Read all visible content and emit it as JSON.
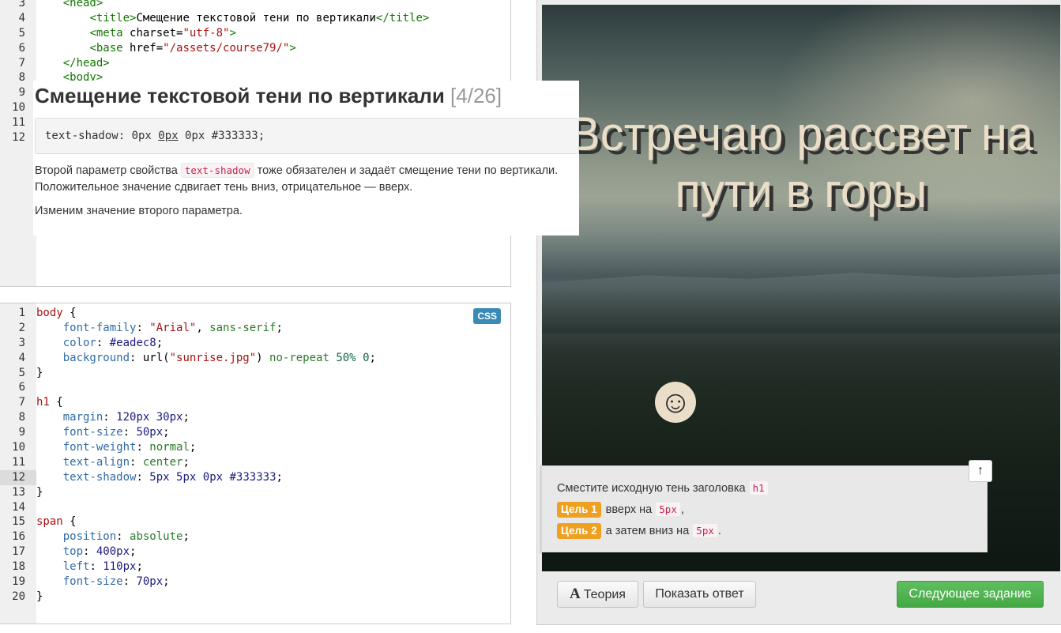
{
  "html_editor": {
    "lines": [
      {
        "n": "3",
        "html": "    <span class='t-html-tag'>&lt;head&gt;</span>"
      },
      {
        "n": "4",
        "html": "        <span class='t-html-tag'>&lt;title&gt;</span>Смещение текстовой тени по вертикали<span class='t-html-tag'>&lt;/title&gt;</span>"
      },
      {
        "n": "5",
        "html": "        <span class='t-html-tag'>&lt;meta</span> charset=<span class='t-str'>\"utf-8\"</span><span class='t-html-tag'>&gt;</span>"
      },
      {
        "n": "6",
        "html": "        <span class='t-html-tag'>&lt;base</span> href=<span class='t-str'>\"/assets/course79/\"</span><span class='t-html-tag'>&gt;</span>"
      },
      {
        "n": "7",
        "html": "    <span class='t-html-tag'>&lt;/head&gt;</span>"
      },
      {
        "n": "8",
        "html": "    <span class='t-html-tag'>&lt;body&gt;</span>"
      },
      {
        "n": "9",
        "html": ""
      },
      {
        "n": "10",
        "html": ""
      },
      {
        "n": "11",
        "html": ""
      },
      {
        "n": "12",
        "html": ""
      }
    ]
  },
  "theory": {
    "title": "Смещение текстовой тени по вертикали",
    "counter": "[4/26]",
    "code_before": "text-shadow: 0px ",
    "code_underlined": "0px",
    "code_after": " 0px #333333;",
    "para1_before": "Второй параметр свойства ",
    "para1_code": "text-shadow",
    "para1_after": " тоже обязателен и задаёт смещение тени по вертикали. Положительное значение сдвигает тень вниз, отрицательное — вверх.",
    "para2": "Изменим значение второго параметра."
  },
  "css_editor": {
    "badge": "CSS",
    "active_line": 12,
    "lines": [
      "<span class='t-sel'>body</span> {",
      "    <span class='t-prop'>font-family</span>: <span class='t-str'>\"Arial\"</span>, <span class='t-kw'>sans-serif</span>;",
      "    <span class='t-prop'>color</span>: <span class='t-color'>#eadec8</span>;",
      "    <span class='t-prop'>background</span>: url(<span class='t-str'>\"sunrise.jpg\"</span>) <span class='t-kw'>no-repeat</span> <span class='t-num'>50%</span> <span class='t-num'>0</span>;",
      "}",
      "",
      "<span class='t-sel'>h1</span> {",
      "    <span class='t-prop'>margin</span>: <span class='t-color'>120px</span> <span class='t-color'>30px</span>;",
      "    <span class='t-prop'>font-size</span>: <span class='t-color'>50px</span>;",
      "    <span class='t-prop'>font-weight</span>: <span class='t-kw'>normal</span>;",
      "    <span class='t-prop'>text-align</span>: <span class='t-kw'>center</span>;",
      "    <span class='t-prop'>text-shadow</span>: <span class='t-color'>5px</span> <span class='t-color'>5px</span> <span class='t-color'>0px</span> <span class='t-color'>#333333</span>;",
      "}",
      "",
      "<span class='t-sel'>span</span> {",
      "    <span class='t-prop'>position</span>: <span class='t-kw'>absolute</span>;",
      "    <span class='t-prop'>top</span>: <span class='t-color'>400px</span>;",
      "    <span class='t-prop'>left</span>: <span class='t-color'>110px</span>;",
      "    <span class='t-prop'>font-size</span>: <span class='t-color'>70px</span>;",
      "}"
    ]
  },
  "preview": {
    "heading": "Встречаю рассвет на пути в горы",
    "smiley": "☺",
    "text_color": "#eadec8",
    "shadow_color": "#333333"
  },
  "task": {
    "instruction_before": "Сместите исходную тень заголовка ",
    "instruction_code": "h1",
    "goal1_badge": "Цель 1",
    "goal1_text": "вверх на ",
    "goal1_code": "5px",
    "goal1_after": ",",
    "goal2_badge": "Цель 2",
    "goal2_text": "а затем вниз на ",
    "goal2_code": "5px",
    "goal2_after": ".",
    "collapse_icon": "↑"
  },
  "buttons": {
    "theory_icon": "A",
    "theory": "Теория",
    "show_answer": "Показать ответ",
    "next": "Следующее задание"
  }
}
